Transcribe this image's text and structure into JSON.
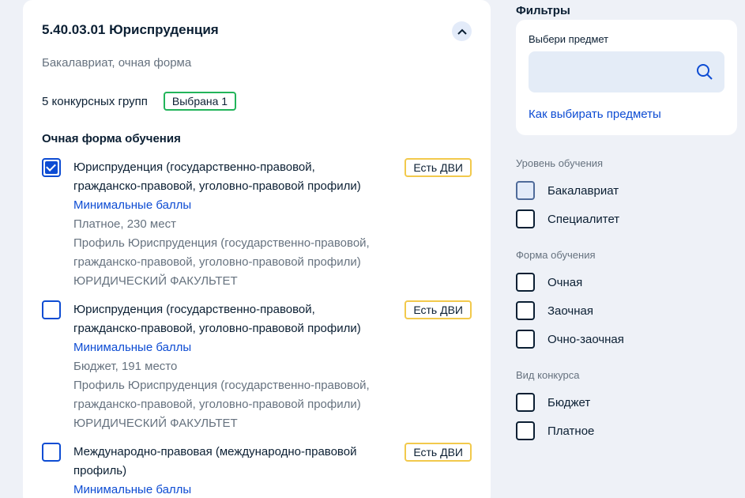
{
  "program_card": {
    "title": "5.40.03.01 Юриспруденция",
    "subtitle": "Бакалавриат, очная форма",
    "groups_count": "5 конкурсных групп",
    "chosen_badge": "Выбрана 1",
    "section_title": "Очная форма обучения",
    "programs": [
      {
        "checked": true,
        "name_line1": "Юриспруденция (государственно-правовой,",
        "name_line2": "гражданско-правовой, уголовно-правовой профили)",
        "min_scores": "Минимальные баллы",
        "places": "Платное, 230 мест",
        "profile_line1": "Профиль Юриспруденция (государственно-правовой,",
        "profile_line2": "гражданско-правовой, уголовно-правовой профили)",
        "faculty": "ЮРИДИЧЕСКИЙ ФАКУЛЬТЕТ",
        "badge": "Есть ДВИ"
      },
      {
        "checked": false,
        "name_line1": "Юриспруденция (государственно-правовой,",
        "name_line2": "гражданско-правовой, уголовно-правовой профили)",
        "min_scores": "Минимальные баллы",
        "places": "Бюджет, 191 место",
        "profile_line1": "Профиль Юриспруденция (государственно-правовой,",
        "profile_line2": "гражданско-правовой, уголовно-правовой профили)",
        "faculty": "ЮРИДИЧЕСКИЙ ФАКУЛЬТЕТ",
        "badge": "Есть ДВИ"
      },
      {
        "checked": false,
        "name_line1": "Международно-правовая (международно-правовой",
        "name_line2": "профиль)",
        "min_scores": "Минимальные баллы",
        "badge": "Есть ДВИ"
      }
    ]
  },
  "filters": {
    "title": "Фильтры",
    "subject_label": "Выбери предмет",
    "search_value": "",
    "how_link": "Как выбирать предметы",
    "level": {
      "title": "Уровень обучения",
      "options": [
        {
          "label": "Бакалавриат",
          "checked": false
        },
        {
          "label": "Специалитет",
          "checked": false
        }
      ]
    },
    "form": {
      "title": "Форма обучения",
      "options": [
        {
          "label": "Очная",
          "checked": false
        },
        {
          "label": "Заочная",
          "checked": false
        },
        {
          "label": "Очно-заочная",
          "checked": false
        }
      ]
    },
    "contest": {
      "title": "Вид конкурса",
      "options": [
        {
          "label": "Бюджет",
          "checked": false
        },
        {
          "label": "Платное",
          "checked": false
        }
      ]
    }
  },
  "colors": {
    "accent": "#0d4cd3",
    "chosen_border": "#22b45a",
    "dvi_border": "#f2c94c",
    "page_bg": "#eef1f7"
  },
  "icons": [
    "chevron-up-icon",
    "check-icon",
    "search-icon"
  ]
}
